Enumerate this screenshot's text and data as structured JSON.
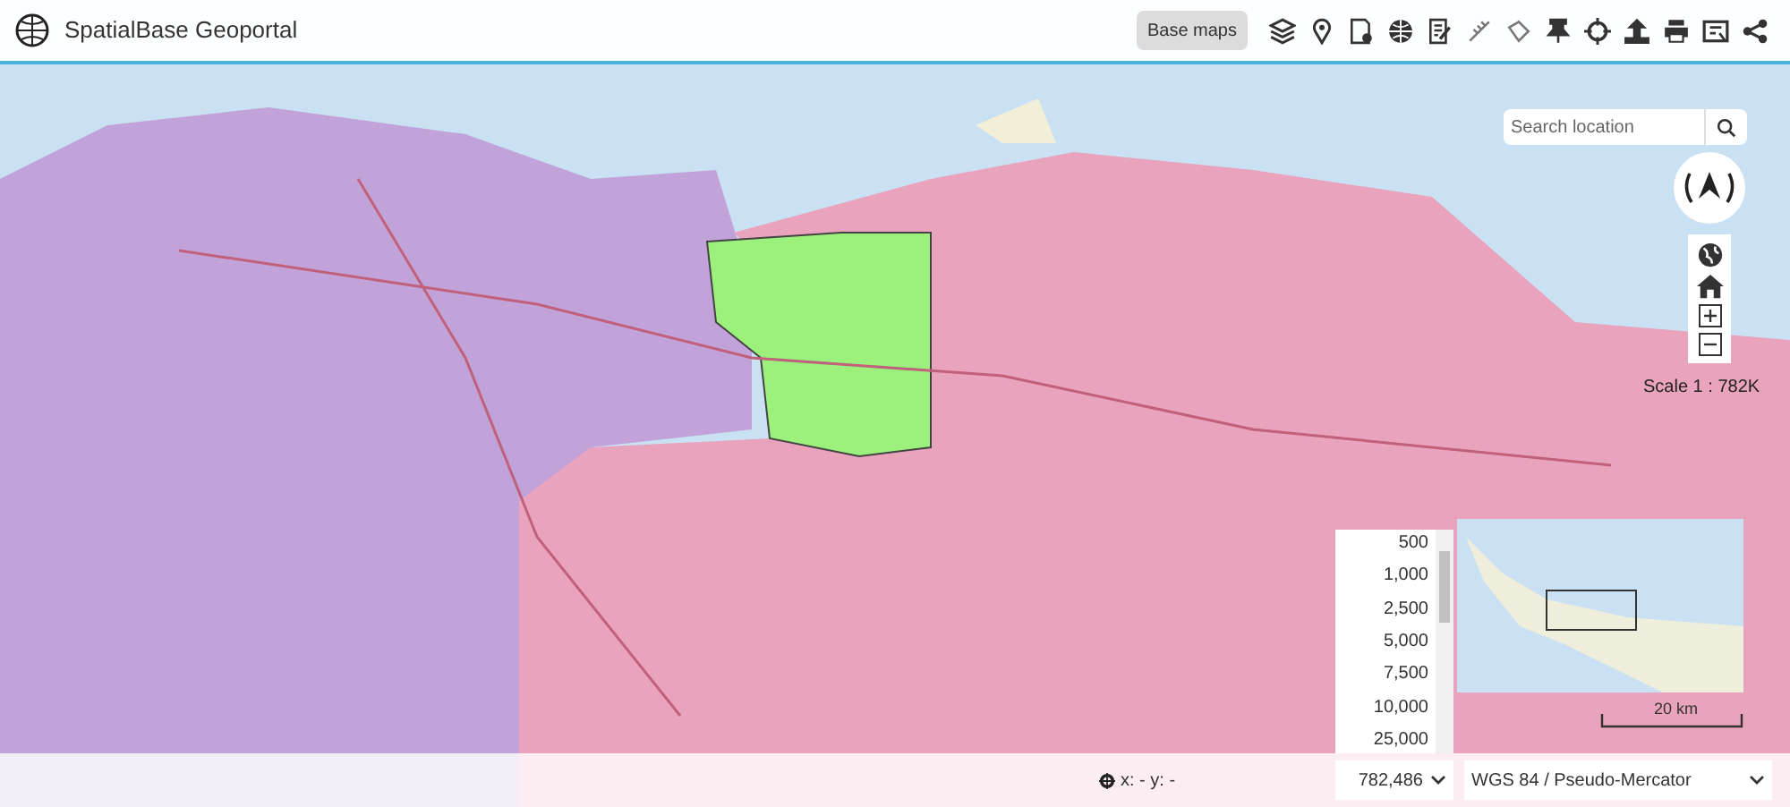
{
  "header": {
    "title": "SpatialBase Geoportal",
    "base_maps_button": "Base maps"
  },
  "search": {
    "placeholder": "Search location"
  },
  "scale_label": "Scale 1 : 782K",
  "overview_map": {
    "scale_bar": "20 km"
  },
  "scale_options": [
    "500",
    "1,000",
    "2,500",
    "5,000",
    "7,500",
    "10,000",
    "25,000"
  ],
  "footer": {
    "coordinates": "x: - y: -",
    "scale_value": "782,486",
    "projection": "WGS 84 / Pseudo-Mercator"
  }
}
